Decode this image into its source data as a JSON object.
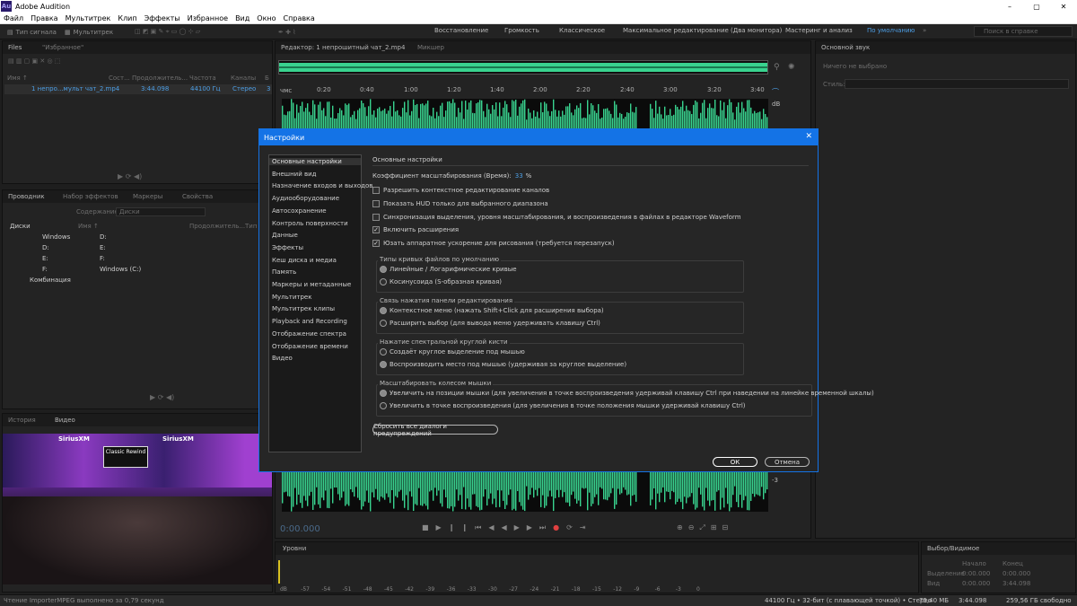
{
  "window": {
    "app_icon": "Au",
    "title": "Adobe Audition",
    "controls": [
      "–",
      "▢",
      "✕"
    ]
  },
  "menu": [
    "Файл",
    "Правка",
    "Мультитрек",
    "Клип",
    "Эффекты",
    "Избранное",
    "Вид",
    "Окно",
    "Справка"
  ],
  "toolbar": {
    "waveform": "Тип сигнала",
    "multitrack": "Мультитрек",
    "workspaces": [
      "Восстановление",
      "Громкость",
      "Классическое",
      "Максимальное редактирование (Два монитора)",
      "Мастеринг и анализ",
      "По умолчанию"
    ],
    "active_workspace": "По умолчанию",
    "search_placeholder": "Поиск в справке"
  },
  "files_panel": {
    "tabs": [
      "Files",
      "\"Избранное\""
    ],
    "columns": [
      "Имя ↑",
      "Сост...",
      "Продолжитель...",
      "Частота",
      "Каналы",
      "Б"
    ],
    "row": {
      "name": "1 непро...мульт чат_2.mp4",
      "duration": "3:44.098",
      "rate": "44100 Гц",
      "channels": "Стерео",
      "bits": "3"
    }
  },
  "media_panel": {
    "tabs": [
      "Проводник",
      "Набор эффектов",
      "Маркеры",
      "Свойства"
    ],
    "content_label": "Содержание:",
    "content_value": "Диски",
    "tree": [
      "Диски",
      "Windows",
      "D:",
      "E:",
      "F:",
      "Комбинация"
    ],
    "columns": [
      "Имя ↑",
      "Продолжитель...",
      "Тип"
    ],
    "items": [
      "D:",
      "E:",
      "F:",
      "Windows (C:)"
    ]
  },
  "video_panel": {
    "tabs": [
      "История",
      "Видео"
    ],
    "banner_left": "SiriusXM",
    "banner_right": "SiriusXM",
    "sign": "Classic Rewind"
  },
  "editor": {
    "tabs": [
      "Редактор: 1 непрошитный чат_2.mp4",
      "Микшер"
    ],
    "time_unit": "чмс",
    "ticks": [
      "0:20",
      "0:40",
      "1:00",
      "1:20",
      "1:40",
      "2:00",
      "2:20",
      "2:40",
      "3:00",
      "3:20",
      "3:40"
    ],
    "db_label": "dB",
    "db_value": "-3",
    "current_time": "0:00.000"
  },
  "essential_sound": {
    "title": "Основной звук",
    "status": "Ничего не выбрано",
    "style_label": "Стиль:"
  },
  "levels": {
    "title": "Уровни",
    "scale": [
      "dB",
      "-57",
      "-54",
      "-51",
      "-48",
      "-45",
      "-42",
      "-39",
      "-36",
      "-33",
      "-30",
      "-27",
      "-24",
      "-21",
      "-18",
      "-15",
      "-12",
      "-9",
      "-6",
      "-3",
      "0"
    ]
  },
  "selection_panel": {
    "title": "Выбор/Видимое",
    "col_start": "Начало",
    "col_end": "Конец",
    "rows": [
      {
        "label": "Выделение",
        "start": "0:00.000",
        "end": "0:00.000"
      },
      {
        "label": "Вид",
        "start": "0:00.000",
        "end": "3:44.098"
      }
    ]
  },
  "status_bar": {
    "message": "Чтение ImporterMPEG выполнено за 0,79 секунд",
    "format": "44100 Гц • 32-бит (с плавающей точкой) • Стерео",
    "size": "75,40 МБ",
    "duration": "3:44.098",
    "free": "259,56 ГБ свободно"
  },
  "dialog": {
    "title": "Настройки",
    "close": "✕",
    "categories": [
      "Основные настройки",
      "Внешний вид",
      "Назначение входов и выходов",
      "Аудиооборудование",
      "Автосохранение",
      "Контроль поверхности",
      "Данные",
      "Эффекты",
      "Кеш диска и медиа",
      "Память",
      "Маркеры и метаданные",
      "Мультитрек",
      "Мультитрек клипы",
      "Playback and Recording",
      "Отображение спектра",
      "Отображение времени",
      "Видео"
    ],
    "section_title": "Основные настройки",
    "zoom_label": "Коэффициент масштабирования (Время):",
    "zoom_value": "33",
    "zoom_unit": "%",
    "checkboxes": [
      {
        "label": "Разрешить контекстное редактирование каналов",
        "checked": false
      },
      {
        "label": "Показать HUD только для выбранного диапазона",
        "checked": false
      },
      {
        "label": "Синхронизация выделения, уровня масштабирования, и воспроизведения в файлах в редакторе Waveform",
        "checked": false
      },
      {
        "label": "Включить расширения",
        "checked": true
      },
      {
        "label": "Юзать аппаратное ускорение для рисования (требуется перезапуск)",
        "checked": true
      }
    ],
    "groups": [
      {
        "title": "Типы кривых файлов по умолчанию",
        "options": [
          "Линейные / Логарифмические кривые",
          "Косинусоида (S-образная кривая)"
        ],
        "selected": 0
      },
      {
        "title": "Связь нажатия панели редактирования",
        "options": [
          "Контекстное меню (нажать Shift+Click для расширения выбора)",
          "Расширить выбор (для вывода меню удерживать клавишу Ctrl)"
        ],
        "selected": 0
      },
      {
        "title": "Нажатие спектральной круглой кисти",
        "options": [
          "Создаёт круглое выделение под мышью",
          "Воспроизводить место под мышью (удерживая за круглое выделение)"
        ],
        "selected": 1
      },
      {
        "title": "Масштабировать колесом мышки",
        "options": [
          "Увеличить на позиции мышки (для увеличения в точке воспроизведения удерживай клавишу Ctrl при наведении на линейке временной шкалы)",
          "Увеличить в точке воспроизведения (для увеличения в точке положения мышки удерживай клавишу Ctrl)"
        ],
        "selected": 0
      }
    ],
    "reset_button": "Сбросить все диалоги предупреждений",
    "ok_button": "ОК",
    "cancel_button": "Отмена"
  },
  "colors": {
    "accent": "#1473e6",
    "waveform": "#39d38f",
    "workspace_active": "#4d9fe6"
  }
}
